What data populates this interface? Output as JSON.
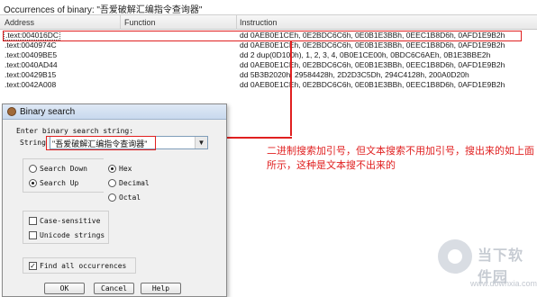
{
  "occurrences": {
    "title": "Occurrences of binary: \"吾爱破解汇编指令查询器\"",
    "columns": [
      "Address",
      "Function",
      "Instruction"
    ],
    "rows": [
      {
        "address": ".text:004016DC",
        "instruction": "dd 0AEB0E1CEh, 0E2BDC6C6h, 0E0B1E3BBh, 0EEC1B8D6h, 0AFD1E9B2h"
      },
      {
        "address": ".text:0040974C",
        "instruction": "dd 0AEB0E1CEh, 0E2BDC6C6h, 0E0B1E3BBh, 0EEC1B8D6h, 0AFD1E9B2h"
      },
      {
        "address": ".text:00409BE5",
        "instruction": "dd 2 dup(0D100h), 1, 2, 3, 4, 0B0E1CE00h, 0BDC6C6AEh, 0B1E3BBE2h"
      },
      {
        "address": ".text:0040AD44",
        "instruction": "dd 0AEB0E1CEh, 0E2BDC6C6h, 0E0B1E3BBh, 0EEC1B8D6h, 0AFD1E9B2h"
      },
      {
        "address": ".text:00429B15",
        "instruction": "dd 5B3B2020h, 29584428h, 2D2D3C5Dh, 294C4128h, 200A0D20h"
      },
      {
        "address": ".text:0042A008",
        "instruction": "dd 0AEB0E1CEh, 0E2BDC6C6h, 0E0B1E3BBh, 0EEC1B8D6h, 0AFD1E9B2h"
      }
    ]
  },
  "annotation": {
    "text": "二进制搜索加引号，但文本搜索不用加引号，搜出来的如上面所示，这种是文本搜不出来的",
    "color": "#e02020"
  },
  "dialog": {
    "title": "Binary search",
    "prompt": "Enter binary search string:",
    "string_label": "String",
    "string_value": "\"吾爱破解汇编指令查询器\"",
    "direction": {
      "down": "Search Down",
      "up": "Search Up",
      "selected": "up"
    },
    "format": {
      "hex": "Hex",
      "decimal": "Decimal",
      "octal": "Octal",
      "selected": "hex"
    },
    "case_sensitive": {
      "label": "Case-sensitive",
      "checked": false
    },
    "unicode": {
      "label": "Unicode strings",
      "checked": false
    },
    "find_all": {
      "label": "Find all occurrences",
      "checked": true
    },
    "buttons": {
      "ok": "OK",
      "cancel": "Cancel",
      "help": "Help"
    }
  },
  "watermark": {
    "name": "当下软件园",
    "url": "www.downxia.com"
  }
}
